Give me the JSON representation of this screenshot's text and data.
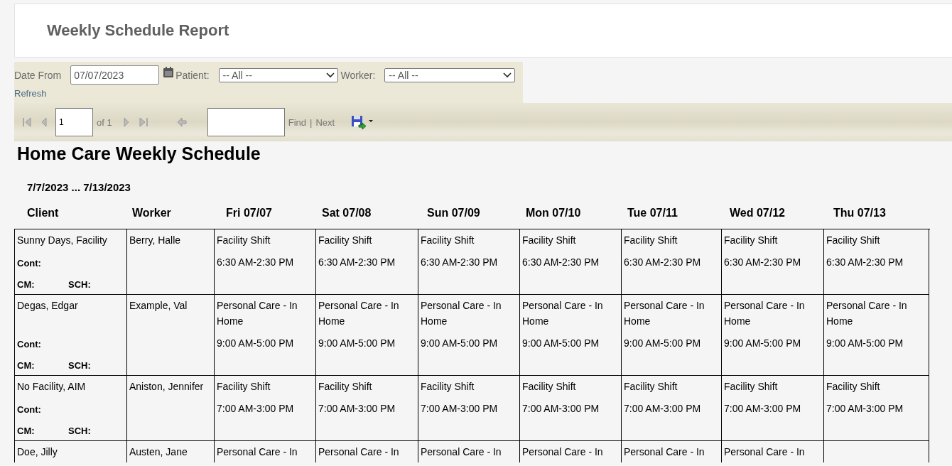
{
  "header": {
    "title": "Weekly Schedule Report"
  },
  "parameters": {
    "date_from": {
      "label": "Date From",
      "value": "07/07/2023"
    },
    "patient": {
      "label": "Patient:",
      "value": "-- All --"
    },
    "worker": {
      "label": "Worker:",
      "value": "-- All --"
    },
    "refresh": "Refresh"
  },
  "toolbar": {
    "page": "1",
    "page_count": "of 1",
    "find": "Find",
    "separator": "|",
    "next": "Next"
  },
  "report": {
    "title": "Home Care Weekly Schedule",
    "date_range": "7/7/2023 ... 7/13/2023",
    "columns": [
      "Client",
      "Worker",
      "Fri 07/07",
      "Sat 07/08",
      "Sun 07/09",
      "Mon 07/10",
      "Tue 07/11",
      "Wed 07/12",
      "Thu 07/13"
    ],
    "rows": [
      {
        "client": "Sunny Days, Facility",
        "worker": "Berry, Halle",
        "cont": "Cont:",
        "cm": "CM:",
        "sch": "SCH:",
        "shifts": [
          {
            "service": "Facility Shift",
            "time": "6:30 AM-2:30 PM"
          },
          {
            "service": "Facility Shift",
            "time": "6:30 AM-2:30 PM"
          },
          {
            "service": "Facility Shift",
            "time": "6:30 AM-2:30 PM"
          },
          {
            "service": "Facility Shift",
            "time": "6:30 AM-2:30 PM"
          },
          {
            "service": "Facility Shift",
            "time": "6:30 AM-2:30 PM"
          },
          {
            "service": "Facility Shift",
            "time": "6:30 AM-2:30 PM"
          },
          {
            "service": "Facility Shift",
            "time": "6:30 AM-2:30 PM"
          }
        ]
      },
      {
        "client": "Degas, Edgar",
        "worker": "Example, Val",
        "cont": "Cont:",
        "cm": "CM:",
        "sch": "SCH:",
        "shifts": [
          {
            "service": "Personal Care - In Home",
            "time": "9:00 AM-5:00 PM"
          },
          {
            "service": "Personal Care - In Home",
            "time": "9:00 AM-5:00 PM"
          },
          {
            "service": "Personal Care - In Home",
            "time": "9:00 AM-5:00 PM"
          },
          {
            "service": "Personal Care - In Home",
            "time": "9:00 AM-5:00 PM"
          },
          {
            "service": "Personal Care - In Home",
            "time": "9:00 AM-5:00 PM"
          },
          {
            "service": "Personal Care - In Home",
            "time": "9:00 AM-5:00 PM"
          },
          {
            "service": "Personal Care - In Home",
            "time": "9:00 AM-5:00 PM"
          }
        ]
      },
      {
        "client": "No Facility, AIM",
        "worker": "Aniston, Jennifer",
        "cont": "Cont:",
        "cm": "CM:",
        "sch": "SCH:",
        "shifts": [
          {
            "service": "Facility Shift",
            "time": "7:00 AM-3:00 PM"
          },
          {
            "service": "Facility Shift",
            "time": "7:00 AM-3:00 PM"
          },
          {
            "service": "Facility Shift",
            "time": "7:00 AM-3:00 PM"
          },
          {
            "service": "Facility Shift",
            "time": "7:00 AM-3:00 PM"
          },
          {
            "service": "Facility Shift",
            "time": "7:00 AM-3:00 PM"
          },
          {
            "service": "Facility Shift",
            "time": "7:00 AM-3:00 PM"
          },
          {
            "service": "Facility Shift",
            "time": "7:00 AM-3:00 PM"
          }
        ]
      },
      {
        "client": "Doe, Jilly",
        "worker": "Austen, Jane",
        "shifts": [
          {
            "service": "Personal Care - In"
          },
          {
            "service": "Personal Care - In"
          },
          {
            "service": "Personal Care - In"
          },
          {
            "service": "Personal Care - In"
          },
          {
            "service": "Personal Care - In"
          },
          {
            "service": "Personal Care - In"
          }
        ]
      }
    ]
  }
}
